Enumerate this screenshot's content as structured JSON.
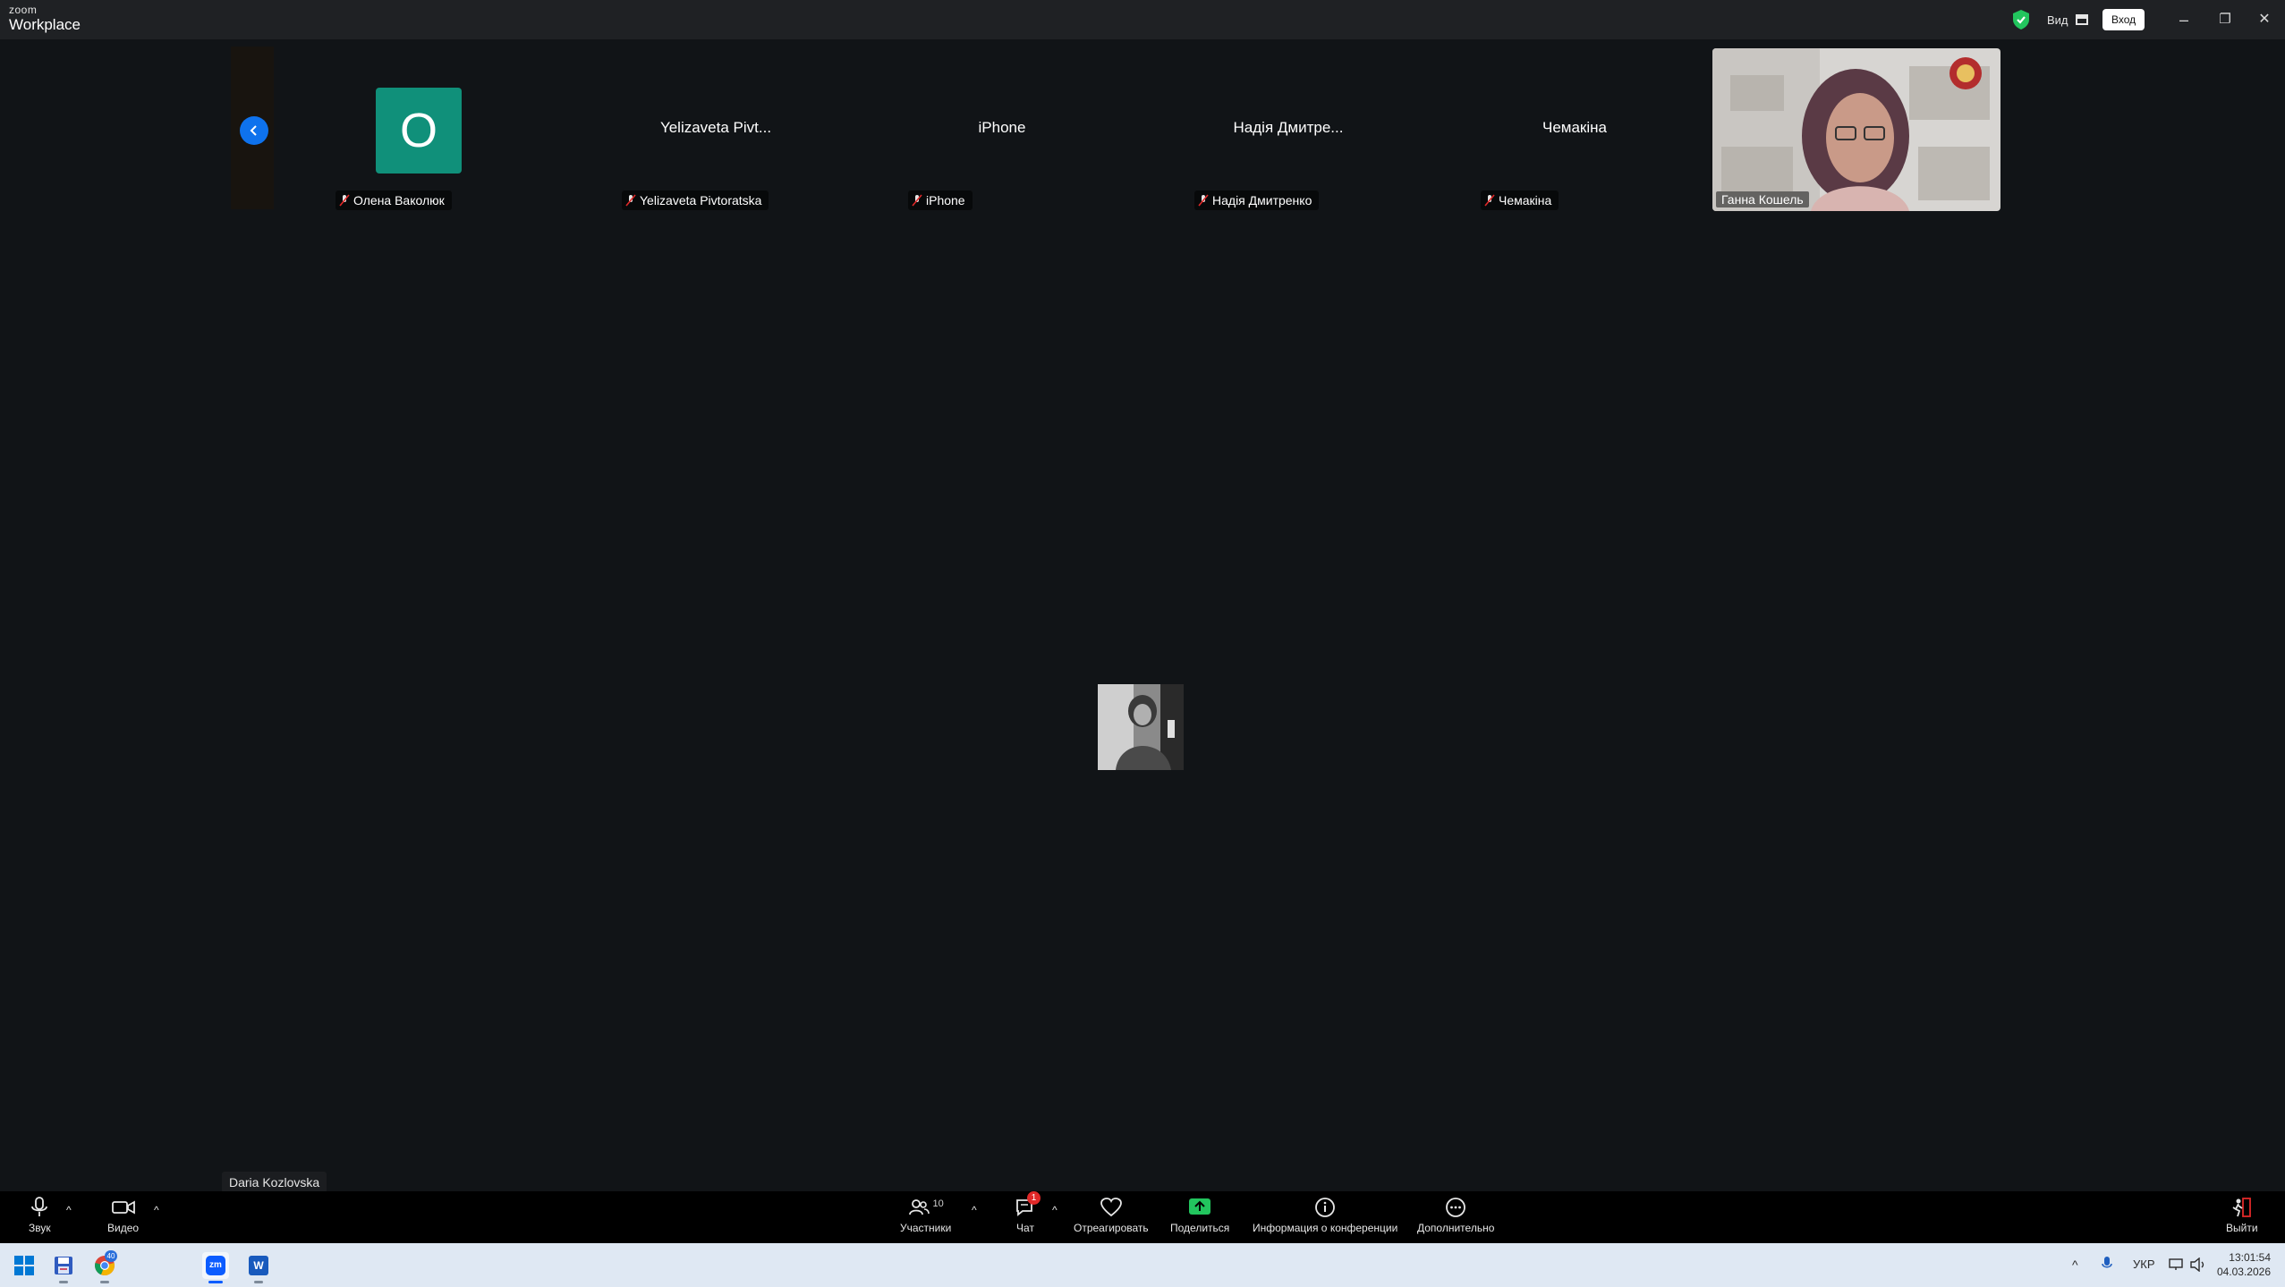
{
  "app": {
    "brand_small": "zoom",
    "brand_large": "Workplace"
  },
  "titlebar": {
    "view_label": "Вид",
    "signin_label": "Вход",
    "minimize": "–",
    "restore": "❐",
    "close": "✕"
  },
  "strip": {
    "tiles": [
      {
        "initial": "О",
        "display": "",
        "label": "Олена Ваколюк"
      },
      {
        "initial": "",
        "display": "Yelizaveta Pivt...",
        "label": "Yelizaveta Pivtoratska"
      },
      {
        "initial": "",
        "display": "iPhone",
        "label": "iPhone"
      },
      {
        "initial": "",
        "display": "Надія Дмитре...",
        "label": "Надія Дмитренко"
      },
      {
        "initial": "",
        "display": "Чемакіна",
        "label": "Чемакіна"
      }
    ],
    "video_tile": {
      "label": "Ганна Кошель"
    }
  },
  "main": {
    "active_speaker_label": "Daria Kozlovska"
  },
  "toolbar": {
    "audio": "Звук",
    "video": "Видео",
    "participants": "Участники",
    "participants_count": "10",
    "chat": "Чат",
    "chat_badge": "1",
    "react": "Отреагировать",
    "share": "Поделиться",
    "info": "Информация о конференции",
    "more": "Дополнительно",
    "leave": "Выйти"
  },
  "taskbar": {
    "chrome_badge": "40",
    "zoom_label": "zm",
    "word_label": "W",
    "lang": "УКР",
    "time": "13:01:54",
    "date": "04.03.2026"
  },
  "colors": {
    "accent_blue": "#0e72ed",
    "avatar_green": "#10907a",
    "share_green": "#22c55e",
    "badge_red": "#e02828",
    "leave_red": "#e02828"
  }
}
